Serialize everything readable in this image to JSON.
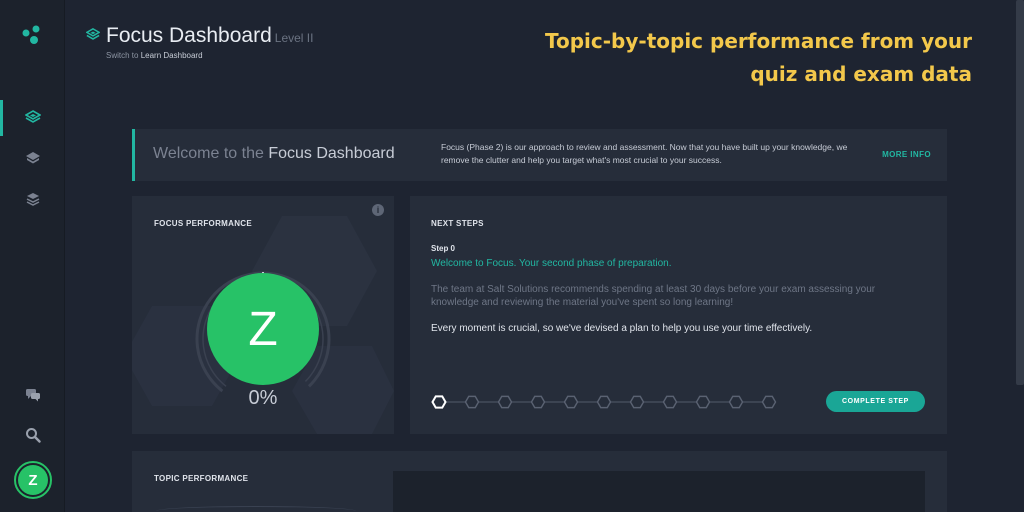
{
  "header": {
    "title": "Focus Dashboard",
    "level": "Level II",
    "switch_prefix": "Switch to",
    "switch_link": "Learn Dashboard"
  },
  "promo": {
    "line1": "Topic-by-topic performance from your",
    "line2": "quiz and exam data"
  },
  "sidebar": {
    "items": [
      {
        "icon": "focus-icon",
        "active": true
      },
      {
        "icon": "learn-icon",
        "active": false
      },
      {
        "icon": "layers-icon",
        "active": false
      },
      {
        "icon": "chat-icon",
        "active": false
      },
      {
        "icon": "search-icon",
        "active": false
      }
    ],
    "avatar_letter": "Z"
  },
  "welcome": {
    "title_prefix": "Welcome to the",
    "title_highlight": "Focus Dashboard",
    "description": "Focus (Phase 2) is our approach to review and assessment. Now that you have built up your knowledge, we remove the clutter and help you target what's most crucial to your success.",
    "more_info": "MORE INFO"
  },
  "focus_performance": {
    "heading": "FOCUS PERFORMANCE",
    "info": "i",
    "letter": "Z",
    "percent_label": "0%",
    "percent_value": 0
  },
  "next_steps": {
    "heading": "NEXT STEPS",
    "step_label": "Step 0",
    "step_title": "Welcome to Focus. Your second phase of preparation.",
    "step_description": "The team at Salt Solutions recommends spending at least 30 days before your exam assessing your knowledge and reviewing the material you've spent so long learning!",
    "step_note": "Every moment is crucial, so we've devised a plan to help you use your time effectively.",
    "total_steps": 11,
    "current_step": 0,
    "complete_button": "COMPLETE STEP"
  },
  "topic_performance": {
    "heading": "TOPIC PERFORMANCE"
  },
  "colors": {
    "accent": "#22b7a2",
    "promo": "#f3c84b",
    "grade": "#27c267",
    "background": "#1e2431",
    "card": "#262d3a"
  }
}
